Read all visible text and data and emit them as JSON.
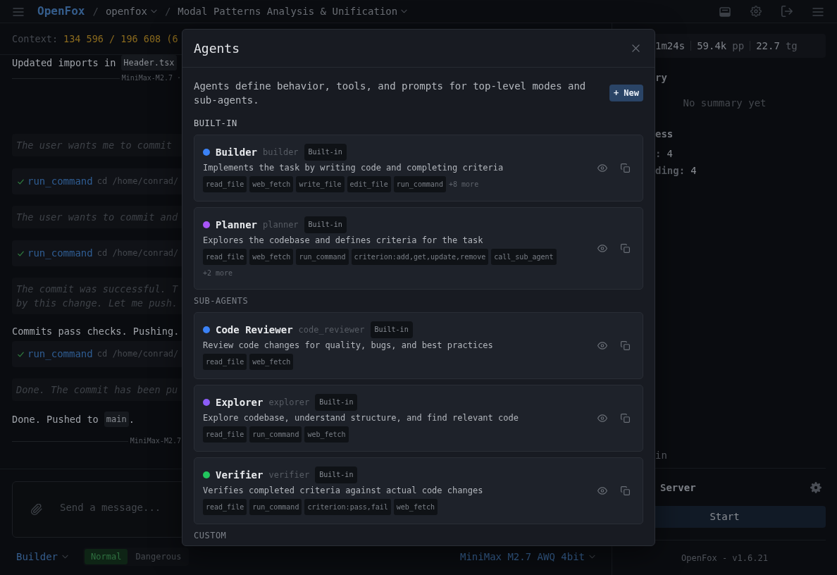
{
  "header": {
    "brand": "OpenFox",
    "breadcrumbs": [
      {
        "separator": "/",
        "label": "openfox"
      },
      {
        "separator": "/",
        "label": "Modal Patterns Analysis & Unification"
      }
    ]
  },
  "context": {
    "label": "Context:",
    "usage": "134 596 / 196 608 (6"
  },
  "chat": [
    {
      "kind": "text",
      "text": "Updated imports in",
      "code": "Header.tsx"
    },
    {
      "kind": "divider",
      "label": "MiniMax-M2.7 ·"
    },
    {
      "kind": "thought",
      "lines": [
        "The user wants me to commit"
      ]
    },
    {
      "kind": "tool",
      "name": "run_command",
      "args": "cd /home/conrad/"
    },
    {
      "kind": "thought",
      "lines": [
        "The user wants to commit and"
      ]
    },
    {
      "kind": "tool",
      "name": "run_command",
      "args": "cd /home/conrad/"
    },
    {
      "kind": "thought",
      "lines": [
        "The commit was successful. T",
        "by this change. Let me push."
      ]
    },
    {
      "kind": "text",
      "text": "Commits pass checks. Pushing."
    },
    {
      "kind": "tool",
      "name": "run_command",
      "args": "cd /home/conrad/"
    },
    {
      "kind": "thought",
      "lines": [
        "Done. The commit has been pu"
      ]
    },
    {
      "kind": "text",
      "text": "Done. Pushed to",
      "code": "main",
      "after": "."
    },
    {
      "kind": "divider",
      "label": "MiniMax-M2.7"
    }
  ],
  "composer": {
    "placeholder": "Send a message..."
  },
  "bottom_bar": {
    "agent": "Builder",
    "modes": [
      {
        "label": "Normal",
        "selected": true
      },
      {
        "label": "Dangerous",
        "selected": false
      }
    ],
    "model": "MiniMax M2.7 AWQ 4bit"
  },
  "side_panel": {
    "stats": [
      {
        "value": "1m24s"
      },
      {
        "value": "59.4k",
        "unit": "pp"
      },
      {
        "value": "22.7",
        "unit": "tg"
      }
    ],
    "summary": {
      "heading": "ry",
      "empty_text": "No summary yet"
    },
    "progress": {
      "heading": "ess",
      "rows": [
        {
          "label": ":",
          "value": "4"
        },
        {
          "label": "ding:",
          "value": "4"
        }
      ]
    },
    "section_label": "in",
    "server": {
      "title": "Server",
      "button": "Start"
    },
    "version": "OpenFox - v1.6.21"
  },
  "modal": {
    "title": "Agents",
    "description": "Agents define behavior, tools, and prompts for top-level modes and sub-agents.",
    "new_button": "+ New",
    "sections": [
      {
        "heading": "BUILT-IN",
        "agents": [
          {
            "name": "Builder",
            "slug": "builder",
            "badge": "Built-in",
            "color": "#3b82f6",
            "description": "Implements the task by writing code and completing criteria",
            "tools": [
              "read_file",
              "web_fetch",
              "write_file",
              "edit_file",
              "run_command"
            ],
            "more": "+8 more"
          },
          {
            "name": "Planner",
            "slug": "planner",
            "badge": "Built-in",
            "color": "#a855f7",
            "description": "Explores the codebase and defines criteria for the task",
            "tools": [
              "read_file",
              "web_fetch",
              "run_command",
              "criterion:add,get,update,remove",
              "call_sub_agent"
            ],
            "more": "+2 more"
          }
        ]
      },
      {
        "heading": "SUB-AGENTS",
        "agents": [
          {
            "name": "Code Reviewer",
            "slug": "code_reviewer",
            "badge": "Built-in",
            "color": "#3b82f6",
            "description": "Review code changes for quality, bugs, and best practices",
            "tools": [
              "read_file",
              "web_fetch"
            ]
          },
          {
            "name": "Explorer",
            "slug": "explorer",
            "badge": "Built-in",
            "color": "#8b5cf6",
            "description": "Explore codebase, understand structure, and find relevant code",
            "tools": [
              "read_file",
              "run_command",
              "web_fetch"
            ]
          },
          {
            "name": "Verifier",
            "slug": "verifier",
            "badge": "Built-in",
            "color": "#22c55e",
            "description": "Verifies completed criteria against actual code changes",
            "tools": [
              "read_file",
              "run_command",
              "criterion:pass,fail",
              "web_fetch"
            ]
          }
        ]
      },
      {
        "heading": "CUSTOM"
      }
    ]
  }
}
